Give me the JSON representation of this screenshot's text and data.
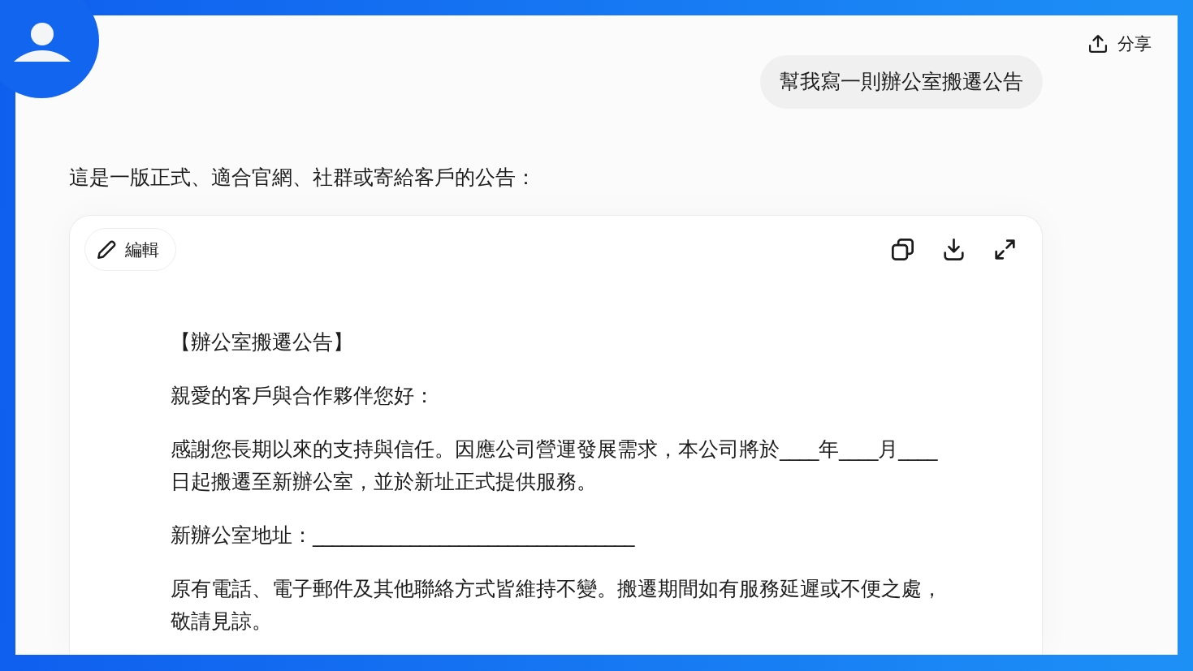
{
  "header": {
    "share_button": {
      "label": "分享"
    }
  },
  "messages": [
    {
      "kind": "user",
      "text": "幫我寫一則辦公室搬遷公告"
    },
    {
      "kind": "assistant",
      "text": "這是一版正式、適合官網、社群或寄給客戶的公告："
    }
  ],
  "document": {
    "edit_button": {
      "label": "編輯"
    },
    "actions": [
      {
        "kind": "copy"
      },
      {
        "kind": "download"
      },
      {
        "kind": "expand"
      }
    ],
    "paragraphs": [
      "【辦公室搬遷公告】",
      "親愛的客戶與合作夥伴您好：",
      "感謝您長期以來的支持與信任。因應公司營運發展需求，本公司將於____年____月____日起搬遷至新辦公室，並於新址正式提供服務。",
      "新辦公室地址：_________________________________",
      "原有電話、電子郵件及其他聯絡方式皆維持不變。搬遷期間如有服務延遲或不便之處，敬請見諒。"
    ]
  }
}
